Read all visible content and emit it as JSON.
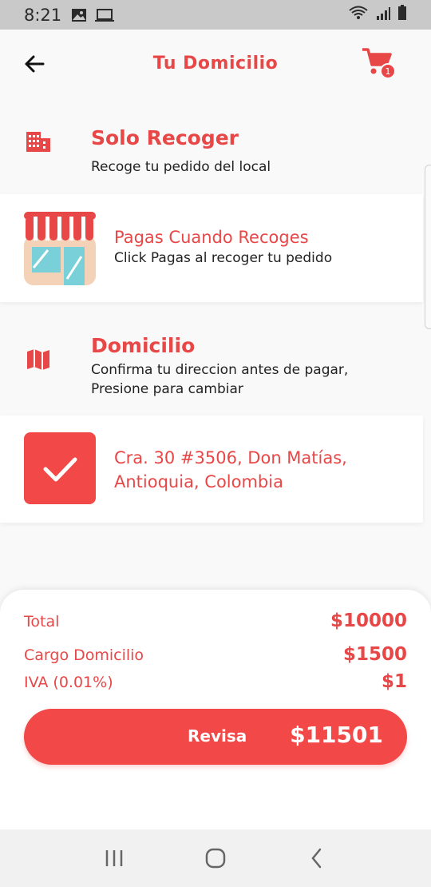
{
  "status_bar": {
    "time": "8:21",
    "icons": [
      "image-icon",
      "laptop-icon",
      "wifi-icon",
      "signal-icon",
      "battery-icon"
    ]
  },
  "header": {
    "title": "Tu Domicilio",
    "cart_count": "1"
  },
  "options": [
    {
      "icon": "building-icon",
      "title": "Solo Recoger",
      "subtitle": "Recoge tu pedido del local"
    },
    {
      "icon": "storefront-icon",
      "title": "Pagas Cuando Recoges",
      "subtitle": "Click Pagas al recoger tu pedido"
    },
    {
      "icon": "map-icon",
      "title": "Domicilio",
      "subtitle_line1": "Confirma tu direccion antes de pagar,",
      "subtitle_line2": "Presione para cambiar"
    }
  ],
  "address": {
    "line1": "Cra. 30 #3506, Don Matías,",
    "line2": "Antioquia, Colombia",
    "selected": true
  },
  "summary": {
    "total_label": "Total",
    "total_value": "$10000",
    "delivery_label": "Cargo Domicilio",
    "delivery_value": "$1500",
    "iva_label": "IVA (0.01%)",
    "iva_value": "$1"
  },
  "checkout": {
    "label": "Revisa",
    "amount": "$11501"
  },
  "colors": {
    "accent": "#e84747",
    "button": "#f24848",
    "status_bar": "#c9c9c9",
    "background": "#f9f9f9"
  }
}
